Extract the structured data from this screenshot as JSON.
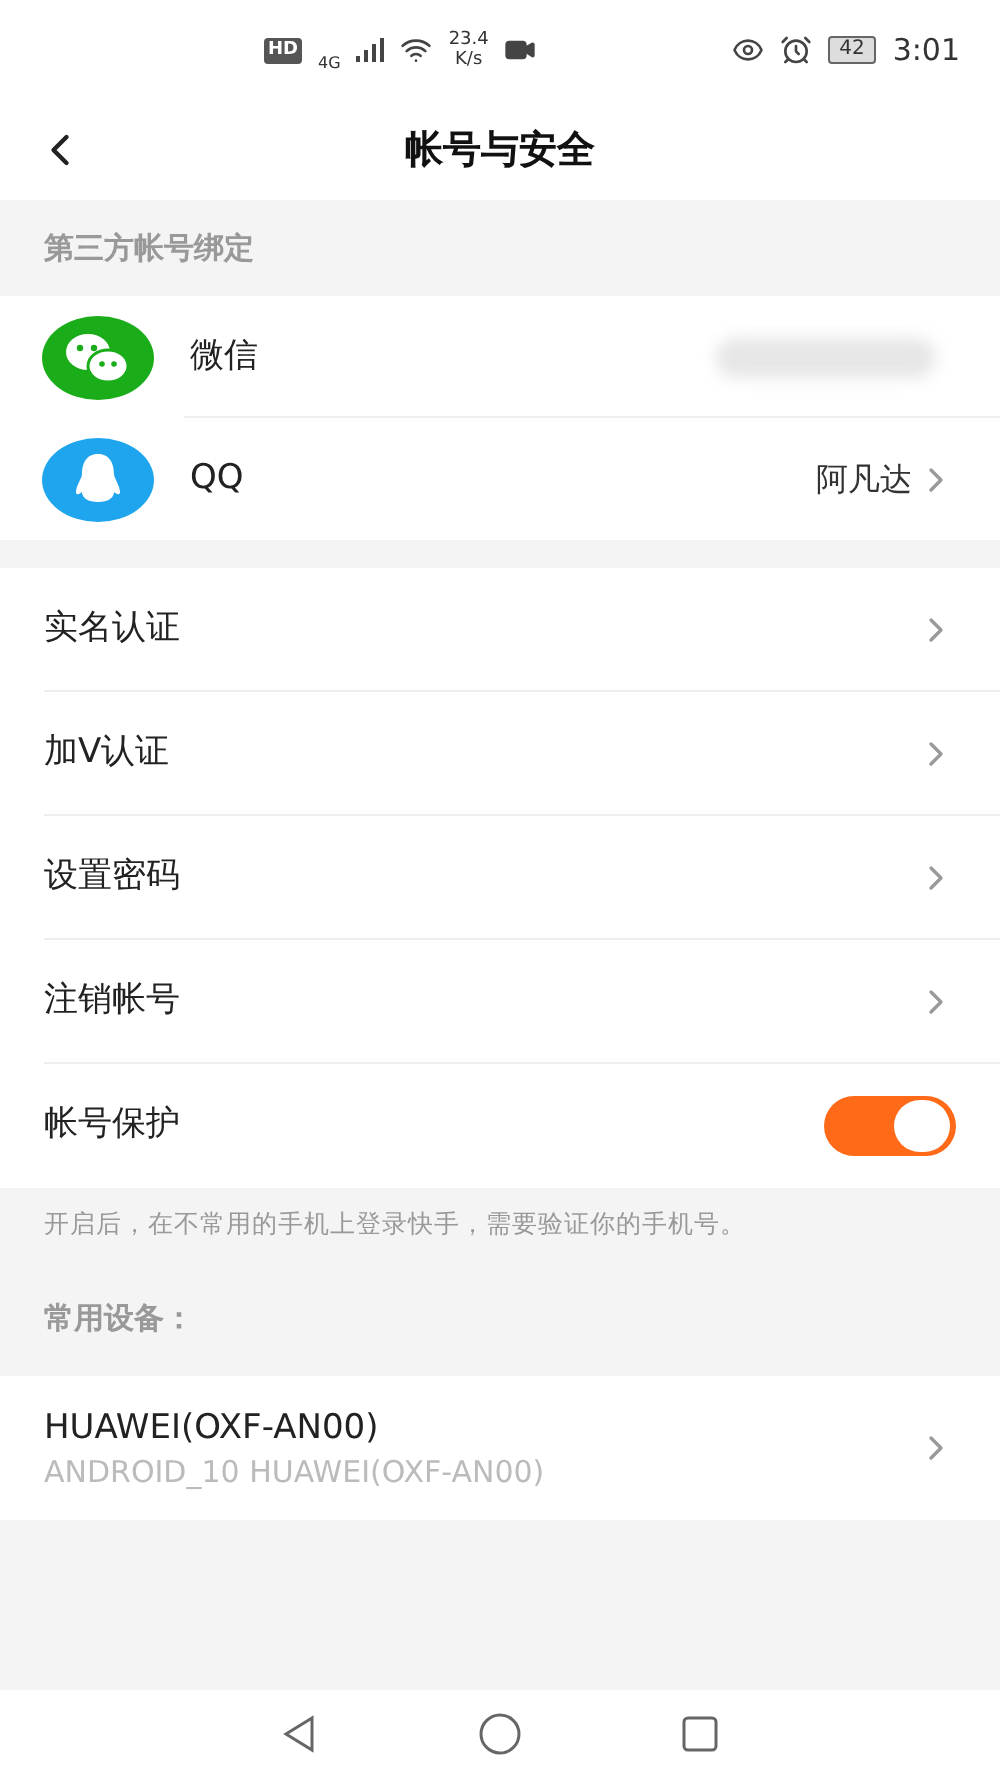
{
  "status_bar": {
    "hd": "HD",
    "network": "4G",
    "speed": "23.4",
    "speed_unit": "K/s",
    "battery": "42",
    "time": "3:01"
  },
  "header": {
    "title": "帐号与安全"
  },
  "third_party": {
    "title": "第三方帐号绑定",
    "accounts": [
      {
        "kind": "wechat",
        "name": "微信",
        "blurred": true
      },
      {
        "kind": "qq",
        "name": "QQ",
        "value": "阿凡达"
      }
    ]
  },
  "settings": [
    {
      "kind": "link",
      "label": "实名认证"
    },
    {
      "kind": "link",
      "label": "加V认证"
    },
    {
      "kind": "link",
      "label": "设置密码"
    },
    {
      "kind": "link",
      "label": "注销帐号"
    },
    {
      "kind": "toggle",
      "label": "帐号保护",
      "on": true
    }
  ],
  "note": "开启后，在不常用的手机上登录快手，需要验证你的手机号。",
  "devices": {
    "title": "常用设备：",
    "items": [
      {
        "name": "HUAWEI(OXF-AN00)",
        "detail": "ANDROID_10 HUAWEI(OXF-AN00)"
      }
    ]
  }
}
